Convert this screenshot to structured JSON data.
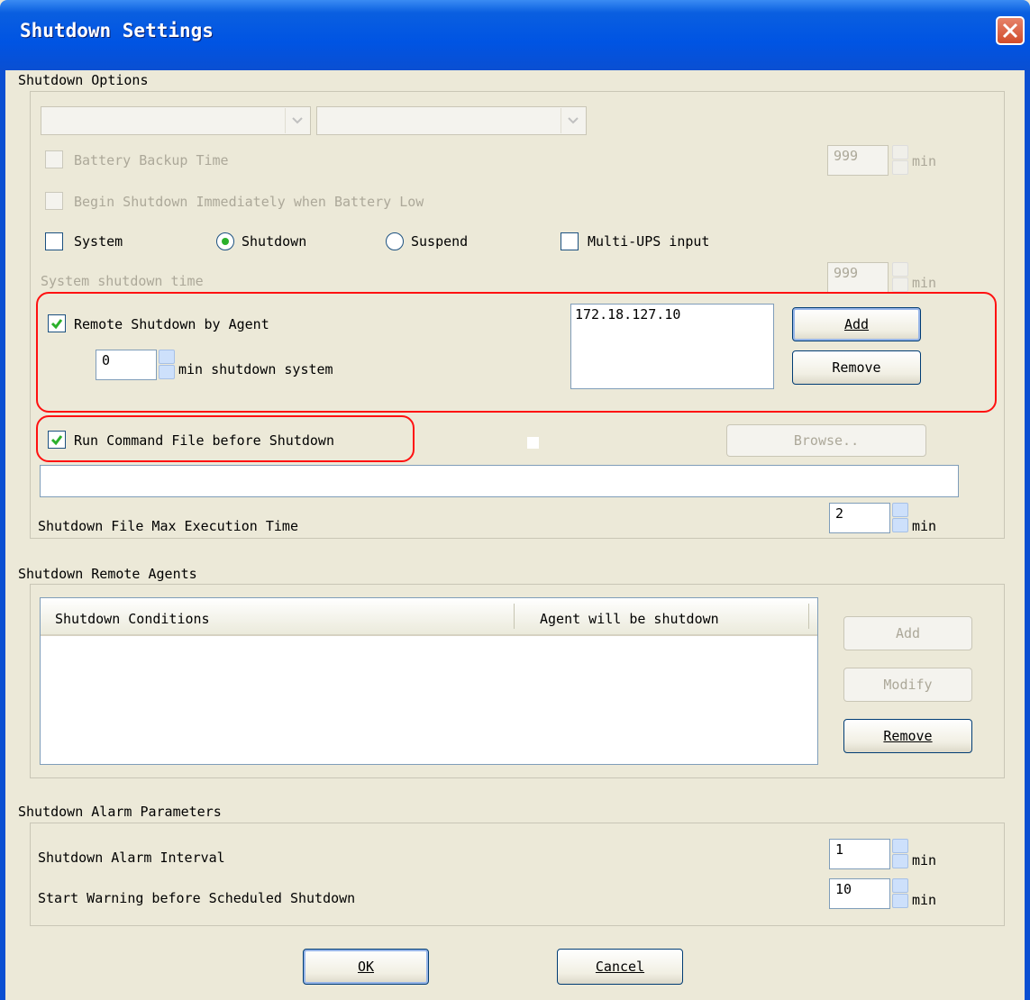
{
  "window": {
    "title": "Shutdown Settings"
  },
  "shutdown_options": {
    "group_title": "Shutdown Options",
    "battery_backup": {
      "label": "Battery Backup Time",
      "value": "999",
      "unit": "min"
    },
    "begin_immediately": {
      "label": "Begin Shutdown Immediately when Battery Low"
    },
    "system": {
      "label": "System"
    },
    "shutdown_radio": {
      "label": "Shutdown",
      "selected": true
    },
    "suspend_radio": {
      "label": "Suspend",
      "selected": false
    },
    "multi_ups": {
      "label": "Multi-UPS input"
    },
    "system_shutdown_time": {
      "label": "System shutdown time",
      "value": "999",
      "unit": "min"
    },
    "remote_shutdown": {
      "label": "Remote Shutdown by Agent",
      "checked": true,
      "minutes": "0",
      "minutes_label": "min shutdown system",
      "agent_list": [
        "172.18.127.10"
      ],
      "add_label": "Add",
      "remove_label": "Remove"
    },
    "run_command": {
      "label": "Run Command File before Shutdown",
      "checked": true,
      "browse_label": "Browse..",
      "file_path": ""
    },
    "max_exec": {
      "label": "Shutdown File Max Execution Time",
      "value": "2",
      "unit": "min"
    }
  },
  "remote_agents": {
    "group_title": "Shutdown Remote Agents",
    "columns": [
      "Shutdown Conditions",
      "Agent will be shutdown"
    ],
    "add_label": "Add",
    "modify_label": "Modify",
    "remove_label": "Remove"
  },
  "alarm": {
    "group_title": "Shutdown Alarm Parameters",
    "interval": {
      "label": "Shutdown Alarm Interval",
      "value": "1",
      "unit": "min"
    },
    "warning": {
      "label": "Start Warning before Scheduled Shutdown",
      "value": "10",
      "unit": "min"
    }
  },
  "footer": {
    "ok_label": "OK",
    "cancel_label": "Cancel"
  },
  "colors": {
    "titlebar": "#0054e3",
    "highlight": "#ff1111",
    "check": "#2bb02b",
    "dialog_bg": "#ece9d8"
  }
}
